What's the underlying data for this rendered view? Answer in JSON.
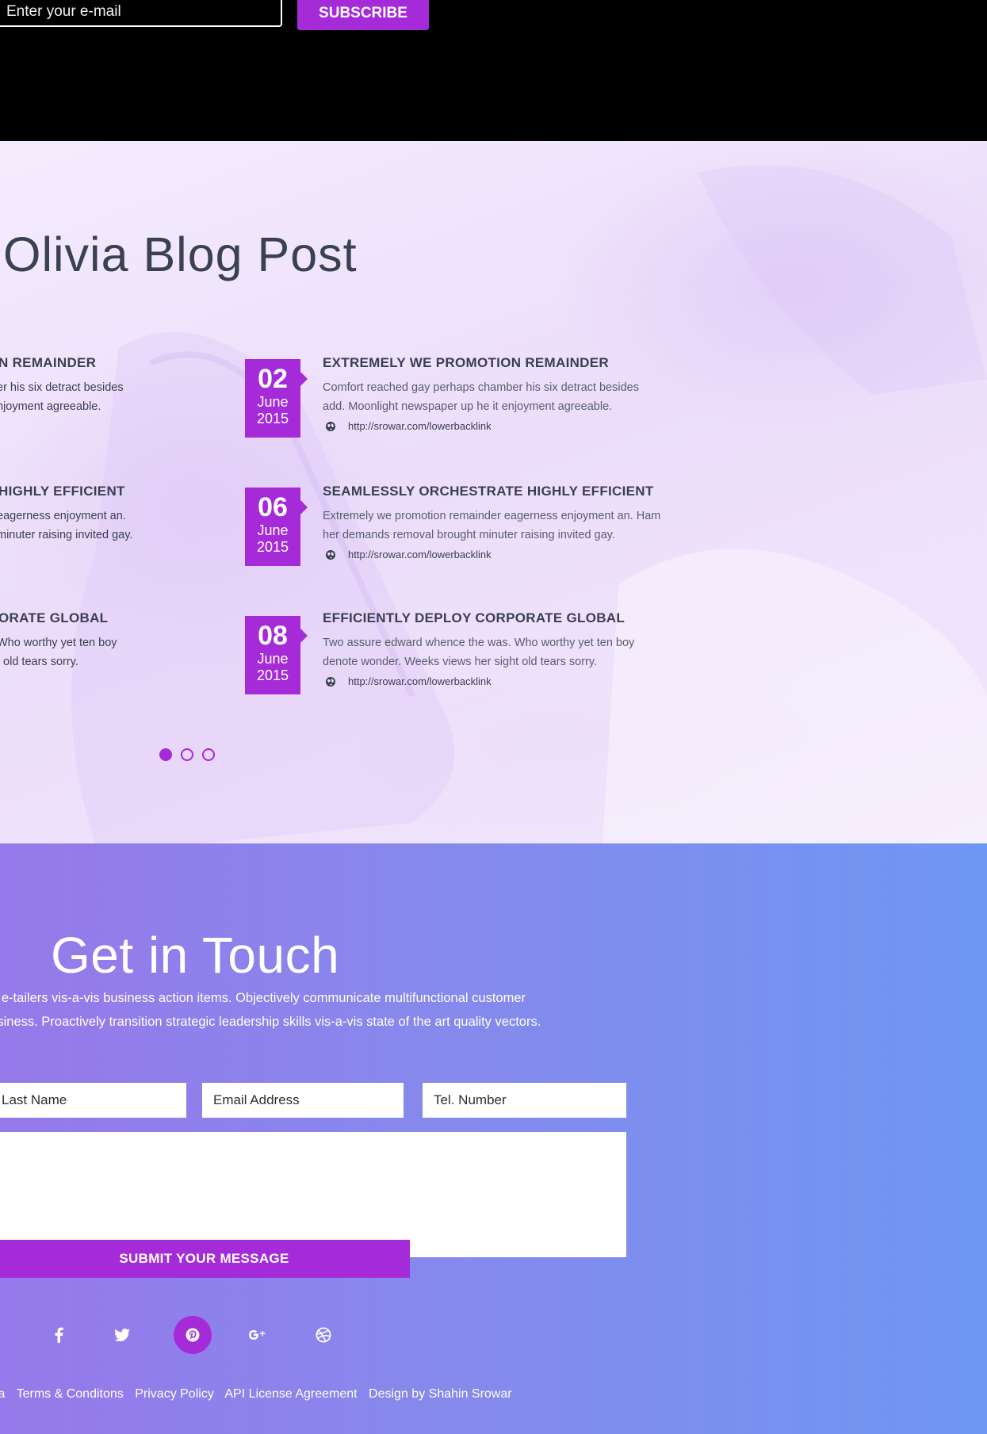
{
  "subscribe": {
    "email_placeholder": "Enter your e-mail",
    "button_label": "SUBSCRIBE"
  },
  "blog": {
    "title": "Olivia Blog Post",
    "left_column": [
      {
        "title": "N REMAINDER",
        "excerpt_line1": "er his six detract besides",
        "excerpt_line2": "njoyment agreeable."
      },
      {
        "title": "HIGHLY EFFICIENT",
        "excerpt_line1": "eagerness enjoyment an.",
        "excerpt_line2": "minuter raising invited gay."
      },
      {
        "title": "ORATE GLOBAL",
        "excerpt_line1": "Who worthy yet ten boy",
        "excerpt_line2": "t old tears sorry."
      }
    ],
    "posts": [
      {
        "day": "02",
        "month": "June",
        "year": "2015",
        "title": "EXTREMELY WE PROMOTION REMAINDER",
        "excerpt": "Comfort reached gay perhaps chamber his six detract besides add. Moonlight newspaper up he it enjoyment agreeable.",
        "link": "http://srowar.com/lowerbacklink"
      },
      {
        "day": "06",
        "month": "June",
        "year": "2015",
        "title": "SEAMLESSLY ORCHESTRATE HIGHLY EFFICIENT",
        "excerpt": "Extremely we promotion remainder eagerness enjoyment an. Ham her demands removal brought minuter raising invited gay.",
        "link": "http://srowar.com/lowerbacklink"
      },
      {
        "day": "08",
        "month": "June",
        "year": "2015",
        "title": "EFFICIENTLY DEPLOY CORPORATE GLOBAL",
        "excerpt": "Two assure edward whence the was. Who worthy yet ten boy denote wonder. Weeks views her sight old tears sorry.",
        "link": "http://srowar.com/lowerbacklink"
      }
    ],
    "carousel": {
      "pages": 3,
      "active_page": 1
    }
  },
  "contact": {
    "title": "Get in Touch",
    "text_line1": "art e-tailers vis-a-vis business action items. Objectively communicate multifunctional customer",
    "text_line2": "business. Proactively transition strategic leadership skills vis-a-vis state of the art quality vectors.",
    "fields": {
      "last_name": "Last Name",
      "email": "Email Address",
      "tel": "Tel. Number"
    },
    "submit_label": "SUBMIT YOUR MESSAGE",
    "social_icons": [
      "facebook-icon",
      "twitter-icon",
      "pinterest-icon",
      "google-plus-icon",
      "dribbble-icon"
    ],
    "active_social": "pinterest-icon"
  },
  "footer": {
    "links": [
      "ia",
      "Terms & Conditons",
      "Privacy Policy",
      "API License Agreement",
      "Design by Shahin Srowar"
    ]
  },
  "colors": {
    "accent": "#a52bd8",
    "title_text": "#3a4150",
    "contact_gradient_start": "#9679ea",
    "contact_gradient_end": "#6e97f2"
  }
}
